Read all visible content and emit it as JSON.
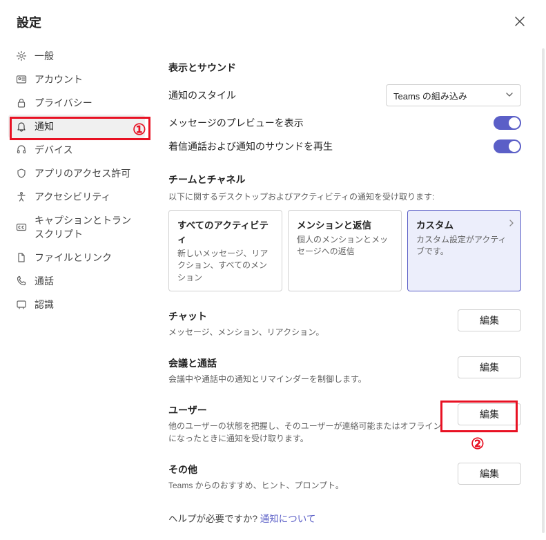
{
  "page_title": "設定",
  "close_label": "閉じる",
  "sidebar": {
    "items": [
      {
        "label": "一般"
      },
      {
        "label": "アカウント"
      },
      {
        "label": "プライバシー"
      },
      {
        "label": "通知"
      },
      {
        "label": "デバイス"
      },
      {
        "label": "アプリのアクセス許可"
      },
      {
        "label": "アクセシビリティ"
      },
      {
        "label": "キャプションとトランスクリプト"
      },
      {
        "label": "ファイルとリンク"
      },
      {
        "label": "通話"
      },
      {
        "label": "認識"
      }
    ],
    "selected_index": 3
  },
  "content": {
    "display_sound": {
      "title": "表示とサウンド",
      "style_label": "通知のスタイル",
      "style_value": "Teams の組み込み",
      "preview_label": "メッセージのプレビューを表示",
      "preview_on": true,
      "sound_label": "着信通話および通知のサウンドを再生",
      "sound_on": true
    },
    "teams_channels": {
      "title": "チームとチャネル",
      "desc": "以下に関するデスクトップおよびアクティビティの通知を受け取ります:",
      "options": [
        {
          "title": "すべてのアクティビティ",
          "desc": "新しいメッセージ、リアクション、すべてのメンション"
        },
        {
          "title": "メンションと返信",
          "desc": "個人のメンションとメッセージへの返信"
        },
        {
          "title": "カスタム",
          "desc": "カスタム設定がアクティブです。"
        }
      ],
      "selected_index": 2
    },
    "groups": [
      {
        "title": "チャット",
        "desc": "メッセージ、メンション、リアクション。",
        "button": "編集"
      },
      {
        "title": "会議と通話",
        "desc": "会議中や通話中の通知とリマインダーを制御します。",
        "button": "編集"
      },
      {
        "title": "ユーザー",
        "desc": "他のユーザーの状態を把握し、そのユーザーが連絡可能またはオフラインになったときに通知を受け取ります。",
        "button": "編集"
      },
      {
        "title": "その他",
        "desc": "Teams からのおすすめ、ヒント、プロンプト。",
        "button": "編集"
      }
    ],
    "help": {
      "prefix": "ヘルプが必要ですか? ",
      "link": "通知について"
    }
  },
  "annotations": {
    "one": "①",
    "two": "②"
  }
}
